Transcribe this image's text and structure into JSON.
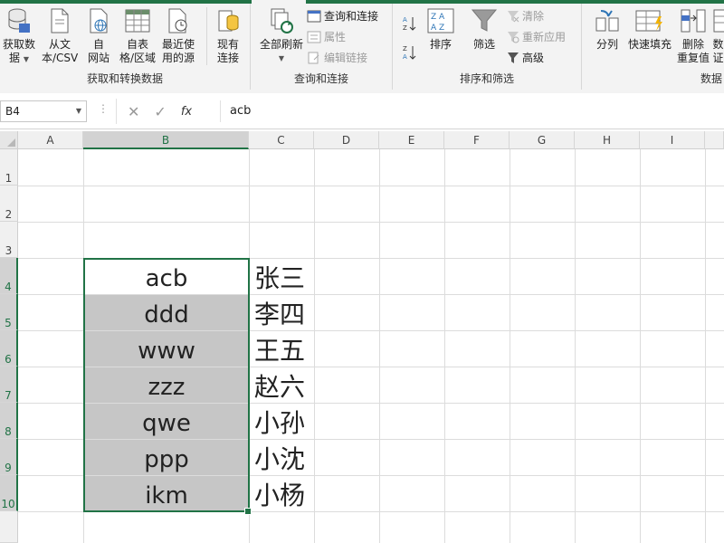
{
  "ribbon": {
    "groups": {
      "get_transform": "获取和转换数据",
      "queries": "查询和连接",
      "sort_filter": "排序和筛选",
      "data_tools": "数据"
    },
    "buttons": {
      "get_data_1": "获取数",
      "get_data_2": "据",
      "from_text_1": "从文",
      "from_text_2": "本/CSV",
      "from_web_1": "自",
      "from_web_2": "网站",
      "from_table_1": "自表",
      "from_table_2": "格/区域",
      "recent_1": "最近使",
      "recent_2": "用的源",
      "existing_1": "现有",
      "existing_2": "连接",
      "refresh_all": "全部刷新",
      "queries_connections": "查询和连接",
      "properties": "属性",
      "edit_links": "编辑链接",
      "sort": "排序",
      "filter": "筛选",
      "clear": "清除",
      "reapply": "重新应用",
      "advanced": "高级",
      "split": "分列",
      "flash_fill": "快速填充",
      "remove_dup_1": "删除",
      "remove_dup_2": "重复值",
      "data_val_1": "数",
      "data_val_2": "证"
    }
  },
  "formula_bar": {
    "name_box": "B4",
    "fx": "fx",
    "content": "acb"
  },
  "grid": {
    "columns": [
      "A",
      "B",
      "C",
      "D",
      "E",
      "F",
      "G",
      "H",
      "I"
    ],
    "rows": [
      "1",
      "2",
      "3",
      "4",
      "5",
      "6",
      "7",
      "8",
      "9",
      "10"
    ],
    "column_b": [
      "acb",
      "ddd",
      "www",
      "zzz",
      "qwe",
      "ppp",
      "ikm"
    ],
    "column_c": [
      "张三",
      "李四",
      "王五",
      "赵六",
      "小孙",
      "小沈",
      "小杨"
    ]
  },
  "colors": {
    "accent": "#217346",
    "selection_fill": "#c6c6c6"
  }
}
